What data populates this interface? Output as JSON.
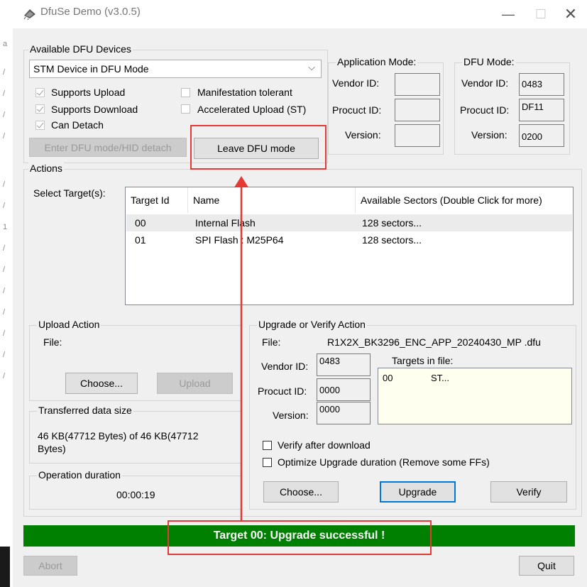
{
  "window": {
    "title": "DfuSe Demo (v3.0.5)",
    "minimize_icon": "minimize-icon",
    "maximize_icon": "maximize-icon",
    "close_icon": "close-icon"
  },
  "background_strip": [
    "a",
    "/",
    "/",
    "/",
    "/",
    "/",
    "/",
    "1",
    "/",
    "/",
    "/",
    "/",
    "/",
    "/",
    "/"
  ],
  "devices": {
    "label": "Available DFU Devices",
    "selected_device": "STM Device in DFU Mode",
    "supports_upload": "Supports Upload",
    "supports_download": "Supports Download",
    "can_detach": "Can Detach",
    "manifestation_tolerant": "Manifestation tolerant",
    "accelerated_upload": "Accelerated Upload (ST)",
    "enter_dfu_button": "Enter DFU mode/HID detach",
    "leave_dfu_button": "Leave DFU mode"
  },
  "app_mode": {
    "label": "Application Mode:",
    "vendor_id_label": "Vendor ID:",
    "product_id_label": "Procuct ID:",
    "version_label": "Version:",
    "vendor_id": "",
    "product_id": "",
    "version": ""
  },
  "dfu_mode": {
    "label": "DFU Mode:",
    "vendor_id_label": "Vendor ID:",
    "product_id_label": "Procuct ID:",
    "version_label": "Version:",
    "vendor_id": "0483",
    "product_id": "DF11",
    "version": "0200"
  },
  "actions": {
    "label": "Actions",
    "select_targets_label": "Select Target(s):",
    "columns": [
      "Target Id",
      "Name",
      "Available Sectors (Double Click for more)"
    ],
    "rows": [
      {
        "id": "00",
        "name": "Internal Flash",
        "sectors": "128 sectors..."
      },
      {
        "id": "01",
        "name": "SPI Flash : M25P64",
        "sectors": "128 sectors..."
      }
    ]
  },
  "upload": {
    "label": "Upload Action",
    "file_label": "File:",
    "choose_button": "Choose...",
    "upload_button": "Upload"
  },
  "transferred": {
    "label": "Transferred data size",
    "text": "46 KB(47712 Bytes) of 46 KB(47712 Bytes)"
  },
  "duration": {
    "label": "Operation duration",
    "value": "00:00:19"
  },
  "upgrade": {
    "label": "Upgrade or Verify Action",
    "file_label": "File:",
    "file_name": "R1X2X_BK3296_ENC_APP_20240430_MP .dfu",
    "vendor_id_label": "Vendor ID:",
    "product_id_label": "Procuct ID:",
    "version_label": "Version:",
    "vendor_id": "0483",
    "product_id": "0000",
    "version": "0000",
    "targets_in_file_label": "Targets in file:",
    "targets_in_file": [
      {
        "id": "00",
        "name": "ST..."
      }
    ],
    "verify_after_download": "Verify after download",
    "optimize_upgrade": "Optimize Upgrade duration (Remove some FFs)",
    "choose_button": "Choose...",
    "upgrade_button": "Upgrade",
    "verify_button": "Verify"
  },
  "status": {
    "message": "Target 00: Upgrade successful !",
    "color": "#008000"
  },
  "footer": {
    "abort_button": "Abort",
    "quit_button": "Quit"
  },
  "annotation": {
    "color": "#e53935"
  }
}
